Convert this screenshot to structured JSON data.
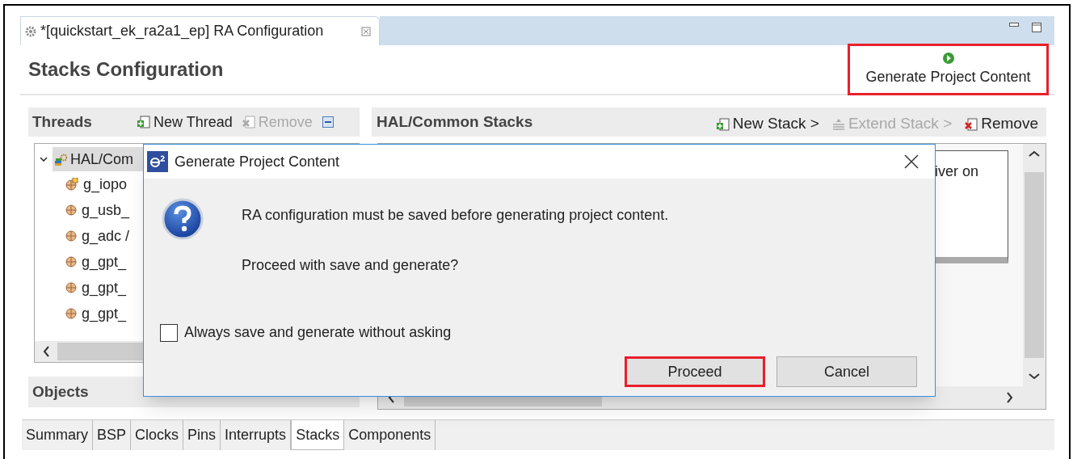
{
  "editor_tab": {
    "title": "*[quickstart_ek_ra2a1_ep] RA Configuration"
  },
  "page_title": "Stacks Configuration",
  "generate_button": {
    "label": "Generate Project Content",
    "highlighted": true
  },
  "threads_panel": {
    "title": "Threads",
    "actions": [
      {
        "kind": "new",
        "label": "New Thread",
        "disabled": false
      },
      {
        "kind": "remove",
        "label": "Remove",
        "disabled": true
      }
    ],
    "tree": [
      {
        "label": "HAL/Com",
        "expanded": true,
        "selected": true,
        "children": [
          {
            "kind": "port",
            "label": "g_iopo"
          },
          {
            "kind": "instance",
            "label": "g_usb_"
          },
          {
            "kind": "instance",
            "label": "g_adc /"
          },
          {
            "kind": "instance",
            "label": "g_gpt_"
          },
          {
            "kind": "instance",
            "label": "g_gpt_"
          },
          {
            "kind": "instance",
            "label": "g_gpt_"
          }
        ]
      }
    ]
  },
  "stacks_panel": {
    "title": "HAL/Common Stacks",
    "actions": [
      {
        "kind": "new",
        "label": "New Stack >",
        "disabled": false
      },
      {
        "kind": "extend",
        "label": "Extend Stack >",
        "disabled": true
      },
      {
        "kind": "remove",
        "label": "Remove",
        "disabled": false
      }
    ],
    "fragment": "iver on"
  },
  "objects_panel": {
    "title": "Objects"
  },
  "bottom_tabs": [
    {
      "label": "Summary",
      "selected": false
    },
    {
      "label": "BSP",
      "selected": false
    },
    {
      "label": "Clocks",
      "selected": false
    },
    {
      "label": "Pins",
      "selected": false
    },
    {
      "label": "Interrupts",
      "selected": false
    },
    {
      "label": "Stacks",
      "selected": true
    },
    {
      "label": "Components",
      "selected": false
    }
  ],
  "dialog": {
    "title": "Generate Project Content",
    "message": "RA configuration must be saved before generating project content.",
    "question": "Proceed with save and generate?",
    "checkbox": {
      "label": "Always save and generate without asking",
      "checked": false
    },
    "buttons": [
      {
        "label": "Proceed",
        "highlighted": true
      },
      {
        "label": "Cancel",
        "highlighted": false
      }
    ]
  }
}
